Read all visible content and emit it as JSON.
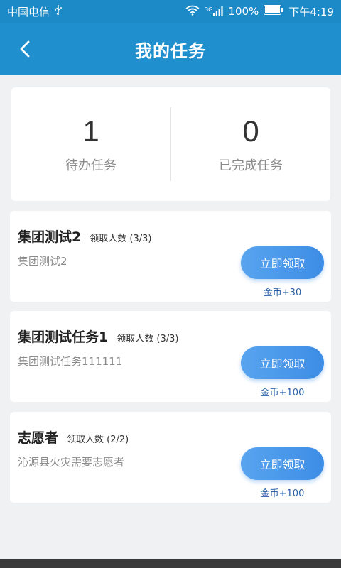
{
  "status_bar": {
    "carrier": "中国电信",
    "usb_icon": "usb-icon",
    "wifi_icon": "wifi-icon",
    "network": "3G",
    "signal_icon": "signal-icon",
    "battery_level": "100%",
    "battery_icon": "battery-icon",
    "time": "下午4:19"
  },
  "nav": {
    "back_icon": "chevron-left-icon",
    "title": "我的任务"
  },
  "summary": {
    "pending": {
      "count": "1",
      "label": "待办任务"
    },
    "completed": {
      "count": "0",
      "label": "已完成任务"
    }
  },
  "tasks": [
    {
      "title": "集团测试2",
      "count_label": "领取人数 (3/3)",
      "description": "集团测试2",
      "button_label": "立即领取",
      "reward": "金币+30"
    },
    {
      "title": "集团测试任务1",
      "count_label": "领取人数 (3/3)",
      "description": "集团测试任务111111",
      "button_label": "立即领取",
      "reward": "金币+100"
    },
    {
      "title": "志愿者",
      "count_label": "领取人数 (2/2)",
      "description": "沁源县火灾需要志愿者",
      "button_label": "立即领取",
      "reward": "金币+100"
    }
  ],
  "colors": {
    "primary": "#1f8fce",
    "button_gradient_start": "#58a4ef",
    "button_gradient_end": "#3d8de6",
    "reward_text": "#2c5fa8"
  }
}
